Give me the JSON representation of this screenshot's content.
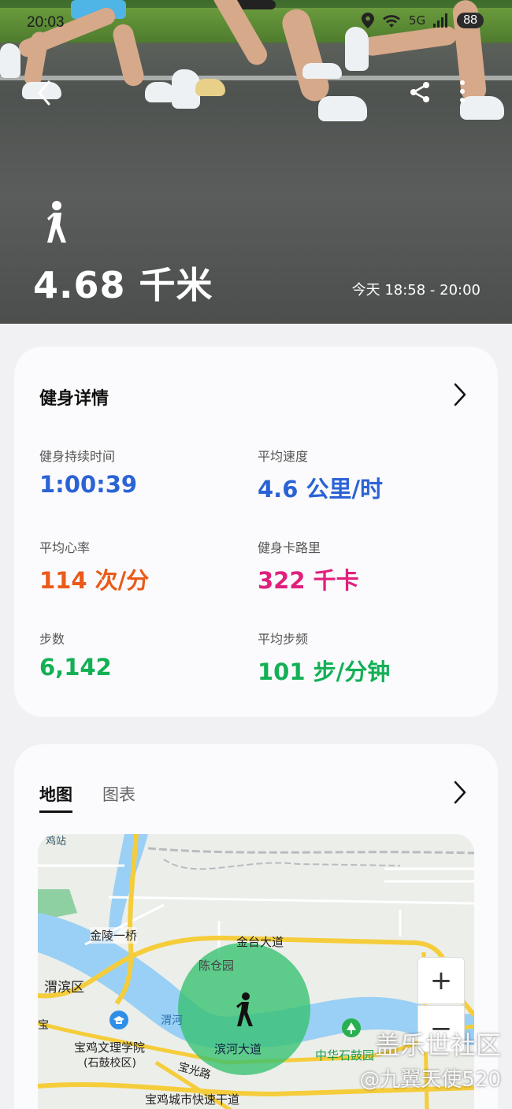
{
  "status_bar": {
    "time": "20:03",
    "signal": "5G",
    "battery": "88"
  },
  "hero": {
    "distance": "4.68 千米",
    "time_range": "今天 18:58 - 20:00"
  },
  "details": {
    "title": "健身详情",
    "metrics": [
      {
        "label": "健身持续时间",
        "value": "1:00:39"
      },
      {
        "label": "平均速度",
        "value": "4.6 公里/时"
      },
      {
        "label": "平均心率",
        "value": "114 次/分"
      },
      {
        "label": "健身卡路里",
        "value": "322 千卡"
      },
      {
        "label": "步数",
        "value": "6,142"
      },
      {
        "label": "平均步频",
        "value": "101 步/分钟"
      }
    ]
  },
  "map_section": {
    "tabs": [
      "地图",
      "图表"
    ],
    "labels": {
      "station": "鸡站",
      "bridge": "金陵一桥",
      "road1": "金台大道",
      "park": "陈仓园",
      "district": "渭滨区",
      "river": "渭河",
      "school": "宝鸡文理学院",
      "campus": "(石鼓校区)",
      "road2": "滨河大道",
      "road3": "宝光路",
      "place": "中华石鼓园",
      "expressway": "宝鸡城市快速干道",
      "edge": "宝"
    },
    "zoom_in": "+",
    "zoom_out": "−"
  },
  "watermark": {
    "line1": "盖乐世社区",
    "line2": "@九翼天使520"
  },
  "colors": {
    "blue": "#2b63d4",
    "orange": "#ea5a1a",
    "magenta": "#e0207b",
    "green": "#13b055"
  }
}
